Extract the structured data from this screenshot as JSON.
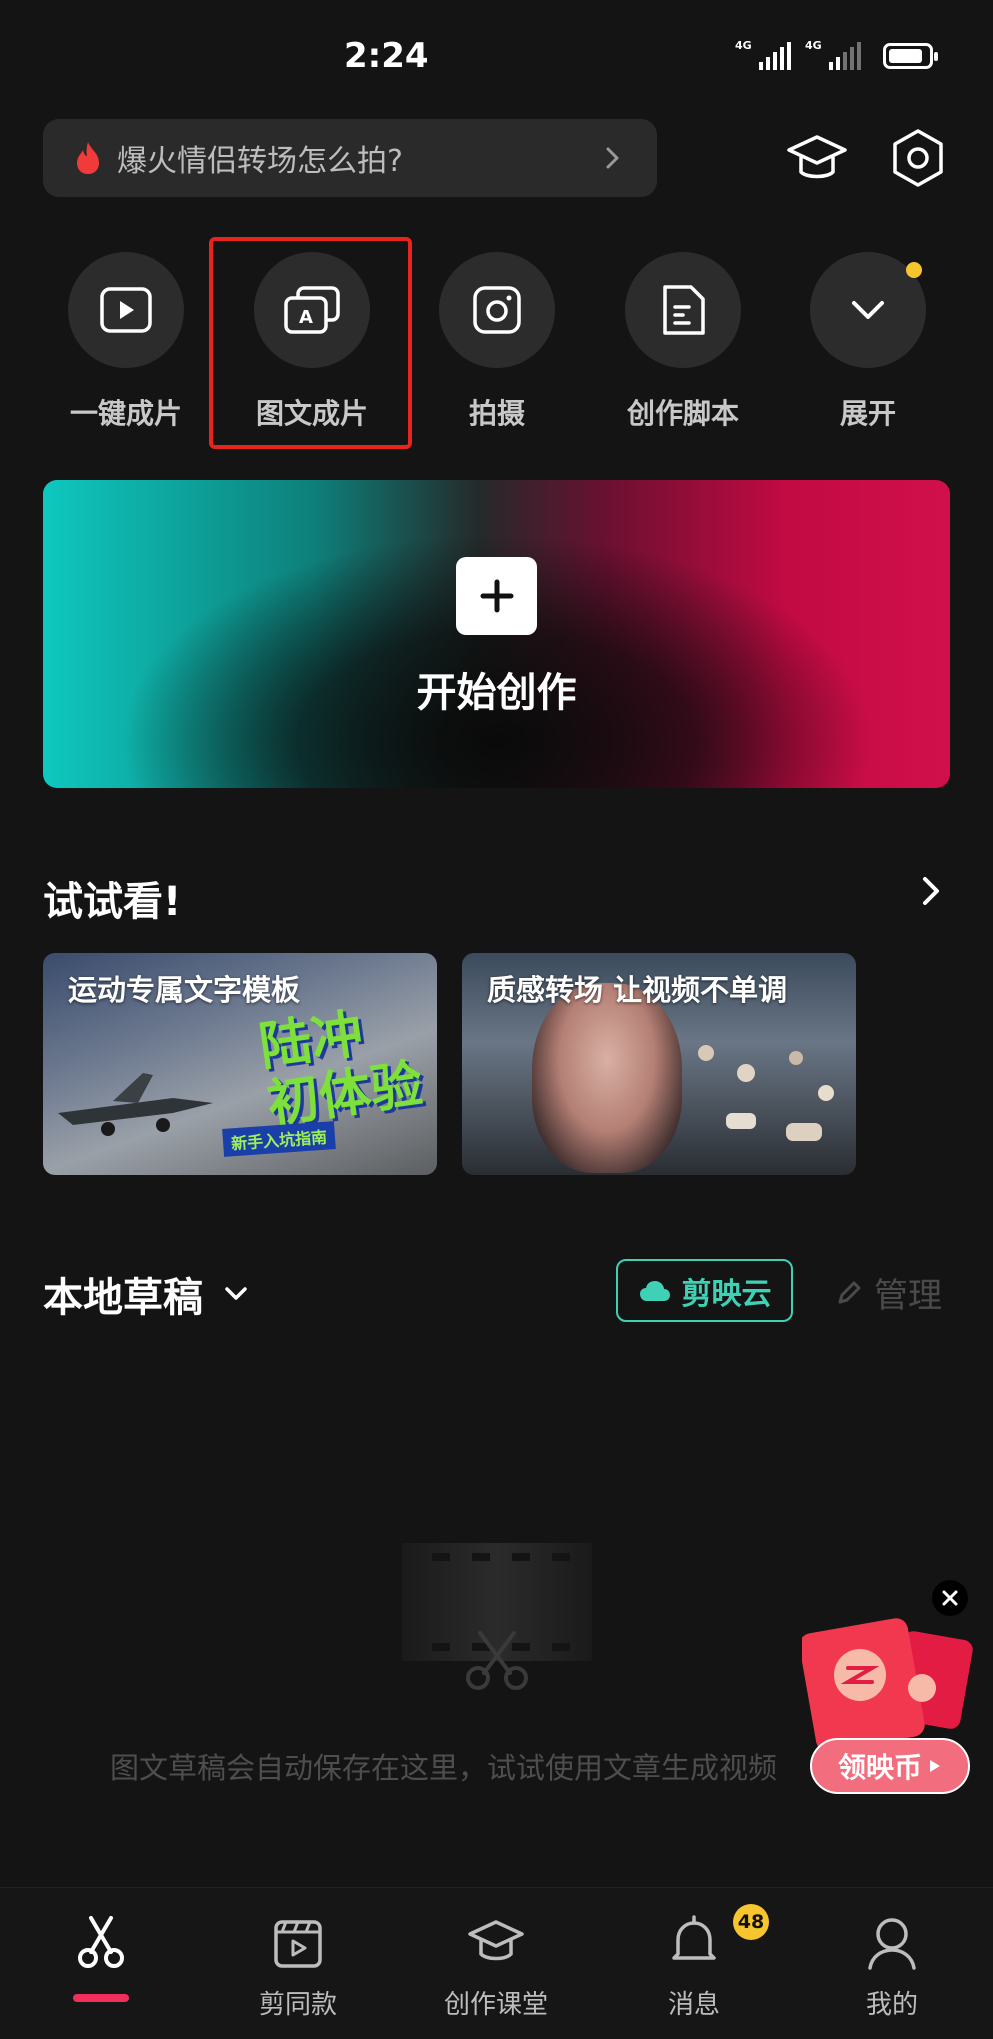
{
  "status_bar": {
    "time": "2:24",
    "signal1_label": "4G",
    "signal2_label": "4G"
  },
  "search": {
    "text": "爆火情侣转场怎么拍?"
  },
  "top_icons": [
    "graduation-cap-icon",
    "settings-hex-icon"
  ],
  "quick_actions": [
    {
      "label": "一键成片",
      "icon": "play-square-icon"
    },
    {
      "label": "图文成片",
      "icon": "image-text-icon",
      "highlighted": true
    },
    {
      "label": "拍摄",
      "icon": "camera-icon"
    },
    {
      "label": "创作脚本",
      "icon": "script-doc-icon"
    },
    {
      "label": "展开",
      "icon": "chevron-down-icon",
      "has_dot": true
    }
  ],
  "start_card": {
    "title": "开始创作"
  },
  "try_section": {
    "title": "试试看!",
    "templates": [
      {
        "caption": "运动专属文字模板",
        "art_line1": "陆冲",
        "art_line2": "初体验",
        "tag": "新手入坑指南"
      },
      {
        "caption": "质感转场 让视频不单调"
      }
    ]
  },
  "drafts": {
    "title": "本地草稿",
    "cloud_label": "剪映云",
    "manage_label": "管理",
    "empty_text": "图文草稿会自动保存在这里，试试使用文章生成视频"
  },
  "promo": {
    "label": "领映币"
  },
  "tabbar": {
    "tabs": [
      {
        "label": "",
        "icon": "scissors-icon",
        "active": true
      },
      {
        "label": "剪同款",
        "icon": "clapper-icon"
      },
      {
        "label": "创作课堂",
        "icon": "graduation-cap-icon"
      },
      {
        "label": "消息",
        "icon": "bell-icon"
      },
      {
        "label": "我的",
        "icon": "person-icon"
      }
    ],
    "message_badge": "48"
  },
  "colors": {
    "accent_teal": "#3fd1b5",
    "accent_red": "#f0305a",
    "highlight_box": "#e8241f",
    "badge_yellow": "#f7c52e"
  }
}
